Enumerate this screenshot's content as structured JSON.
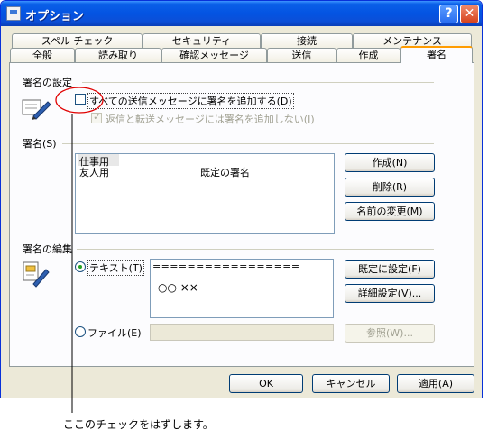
{
  "window": {
    "title": "オプション",
    "help": "?",
    "close": "✕"
  },
  "tabs_back": [
    "スペル チェック",
    "セキュリティ",
    "接続",
    "メンテナンス"
  ],
  "tabs_front": [
    "全般",
    "読み取り",
    "確認メッセージ",
    "送信",
    "作成",
    "署名"
  ],
  "active_tab": "署名",
  "signature_settings": {
    "heading": "署名の設定",
    "add_all_label": "すべての送信メッセージに署名を追加する(D)",
    "no_reply_label": "返信と転送メッセージには署名を追加しない(I)"
  },
  "signatures": {
    "heading": "署名(S)",
    "items": [
      {
        "name": "仕事用",
        "default": ""
      },
      {
        "name": "友人用",
        "default": "既定の署名"
      }
    ],
    "new_button": "作成(N)",
    "delete_button": "削除(R)",
    "rename_button": "名前の変更(M)"
  },
  "edit": {
    "heading": "署名の編集",
    "text_option": "テキスト(T)",
    "text_line1": "=================",
    "text_line2": "○○ ××",
    "set_default_button": "既定に設定(F)",
    "advanced_button": "詳細設定(V)...",
    "file_option": "ファイル(E)",
    "browse_button": "参照(W)..."
  },
  "footer": {
    "ok": "OK",
    "cancel": "キャンセル",
    "apply": "適用(A)"
  },
  "annotation": {
    "text": "ここのチェックをはずします。",
    "color": "#e00000"
  }
}
